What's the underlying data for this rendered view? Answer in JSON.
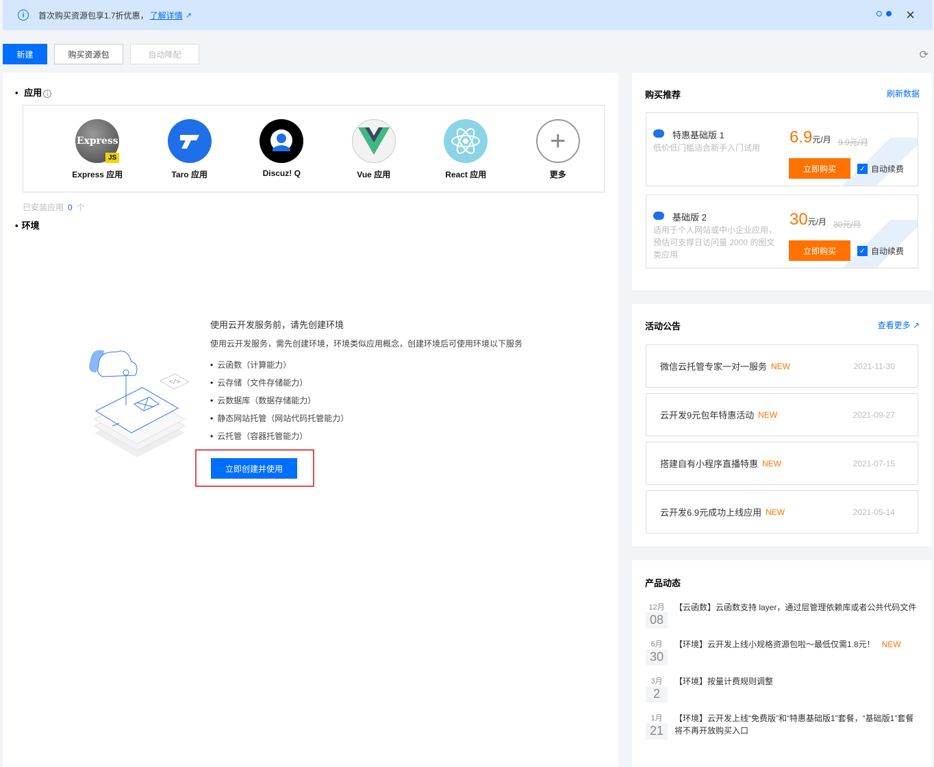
{
  "banner": {
    "text": "首次购买资源包享1.7折优惠，",
    "link": "了解详情"
  },
  "toolbar": {
    "new": "新建",
    "buy": "购买资源包",
    "auto": "自动降配"
  },
  "apps_section": {
    "title": "应用",
    "items": [
      {
        "name": "Express 应用"
      },
      {
        "name": "Taro 应用"
      },
      {
        "name": "Discuz! Q"
      },
      {
        "name": "Vue 应用"
      },
      {
        "name": "React 应用"
      },
      {
        "name": "更多"
      }
    ],
    "express_logo_text": "Express",
    "express_js": "JS",
    "installed_label": "已安装应用",
    "installed_count": "0",
    "installed_unit": "个"
  },
  "env_section": {
    "title": "环境",
    "heading": "使用云开发服务前，请先创建环境",
    "desc": "使用云开发服务，需先创建环境，环境类似应用概念，创建环境后可使用环境以下服务",
    "services": [
      "云函数（计算能力）",
      "云存储（文件存储能力）",
      "云数据库（数据存储能力）",
      "静态网站托管（网站代码托管能力）",
      "云托管（容器托管能力）"
    ],
    "create_button": "立即创建并使用"
  },
  "buy_recommend": {
    "title": "购买推荐",
    "refresh": "刷新数据",
    "packages": [
      {
        "name": "特惠基础版 1",
        "desc": "低价低门槛适合新手入门试用",
        "price": "6.9",
        "unit": "元/月",
        "old": "9.9元/月",
        "buy": "立即购买",
        "auto": "自动续费"
      },
      {
        "name": "基础版 2",
        "desc": "适用于个人网站或中小企业应用，预估可支撑日访问量 2000 的图文类应用",
        "price": "30",
        "unit": "元/月",
        "old": "30元/月",
        "buy": "立即购买",
        "auto": "自动续费"
      }
    ]
  },
  "announcements": {
    "title": "活动公告",
    "more": "查看更多",
    "items": [
      {
        "text": "微信云托管专家一对一服务",
        "tag": "NEW",
        "date": "2021-11-30"
      },
      {
        "text": "云开发9元包年特惠活动",
        "tag": "NEW",
        "date": "2021-09-27"
      },
      {
        "text": "搭建自有小程序直播特惠",
        "tag": "NEW",
        "date": "2021-07-15"
      },
      {
        "text": "云开发6.9元成功上线应用",
        "tag": "NEW",
        "date": "2021-05-14"
      }
    ]
  },
  "product_news": {
    "title": "产品动态",
    "items": [
      {
        "month": "12月",
        "day": "08",
        "text": "【云函数】云函数支持 layer，通过层管理依赖库或者公共代码文件",
        "tag": ""
      },
      {
        "month": "6月",
        "day": "30",
        "text": "【环境】云开发上线小规格资源包啦～最低仅需1.8元！",
        "tag": "NEW"
      },
      {
        "month": "3月",
        "day": "2",
        "text": "【环境】按量计费规则调整",
        "tag": ""
      },
      {
        "month": "1月",
        "day": "21",
        "text": "【环境】云开发上线“免费版”和“特惠基础版1”套餐，“基础版1”套餐将不再开放购买入口",
        "tag": ""
      }
    ]
  },
  "colors": {
    "primary": "#006eff",
    "orange": "#ff7200",
    "banner_bg": "#d5e7fd"
  }
}
